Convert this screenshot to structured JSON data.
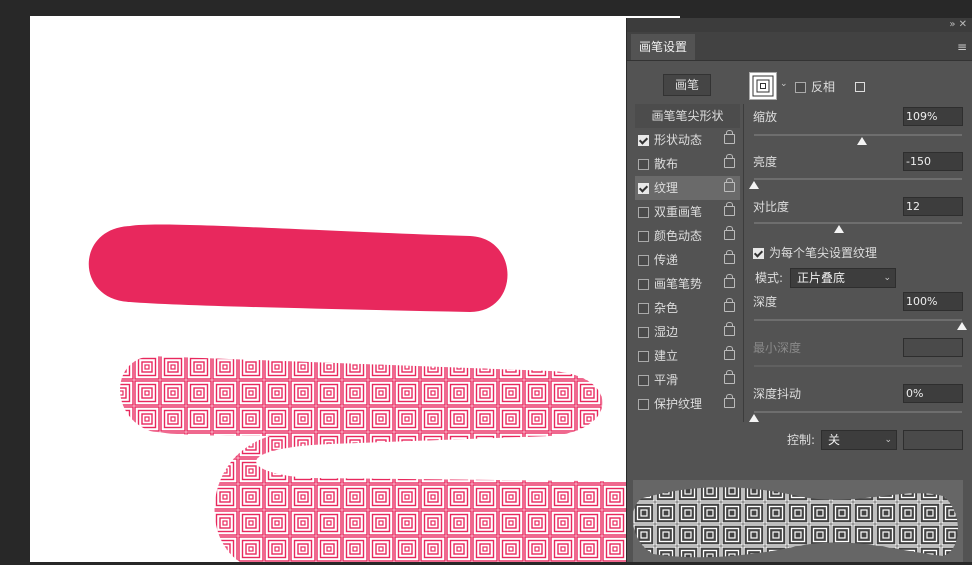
{
  "panel": {
    "close_glyphs": "»  ✕",
    "tab_label": "画笔设置",
    "menu_glyph": "≡",
    "brush_button": "画笔",
    "invert_label": "反相",
    "tip_shape_heading": "画笔笔尖形状"
  },
  "options": [
    {
      "label": "形状动态",
      "checked": true,
      "selected": false
    },
    {
      "label": "散布",
      "checked": false,
      "selected": false
    },
    {
      "label": "纹理",
      "checked": true,
      "selected": true
    },
    {
      "label": "双重画笔",
      "checked": false,
      "selected": false
    },
    {
      "label": "颜色动态",
      "checked": false,
      "selected": false
    },
    {
      "label": "传递",
      "checked": false,
      "selected": false
    },
    {
      "label": "画笔笔势",
      "checked": false,
      "selected": false
    },
    {
      "label": "杂色",
      "checked": false,
      "selected": false
    },
    {
      "label": "湿边",
      "checked": false,
      "selected": false
    },
    {
      "label": "建立",
      "checked": false,
      "selected": false
    },
    {
      "label": "平滑",
      "checked": false,
      "selected": false
    },
    {
      "label": "保护纹理",
      "checked": false,
      "selected": false
    }
  ],
  "texture": {
    "scale_label": "缩放",
    "scale_value": "109%",
    "scale_level": 0.52,
    "brightness_label": "亮度",
    "brightness_value": "-150",
    "brightness_level": 0.0,
    "contrast_label": "对比度",
    "contrast_value": "12",
    "contrast_level": 0.41,
    "per_tip_label": "为每个笔尖设置纹理",
    "per_tip_checked": true,
    "mode_label": "模式:",
    "mode_value": "正片叠底",
    "depth_label": "深度",
    "depth_value": "100%",
    "depth_level": 1.0,
    "min_depth_label": "最小深度",
    "depth_jitter_label": "深度抖动",
    "depth_jitter_value": "0%",
    "depth_jitter_level": 0.0,
    "control_label": "控制:",
    "control_value": "关"
  },
  "colors": {
    "stroke": "#E8285D",
    "panel": "#535353"
  }
}
